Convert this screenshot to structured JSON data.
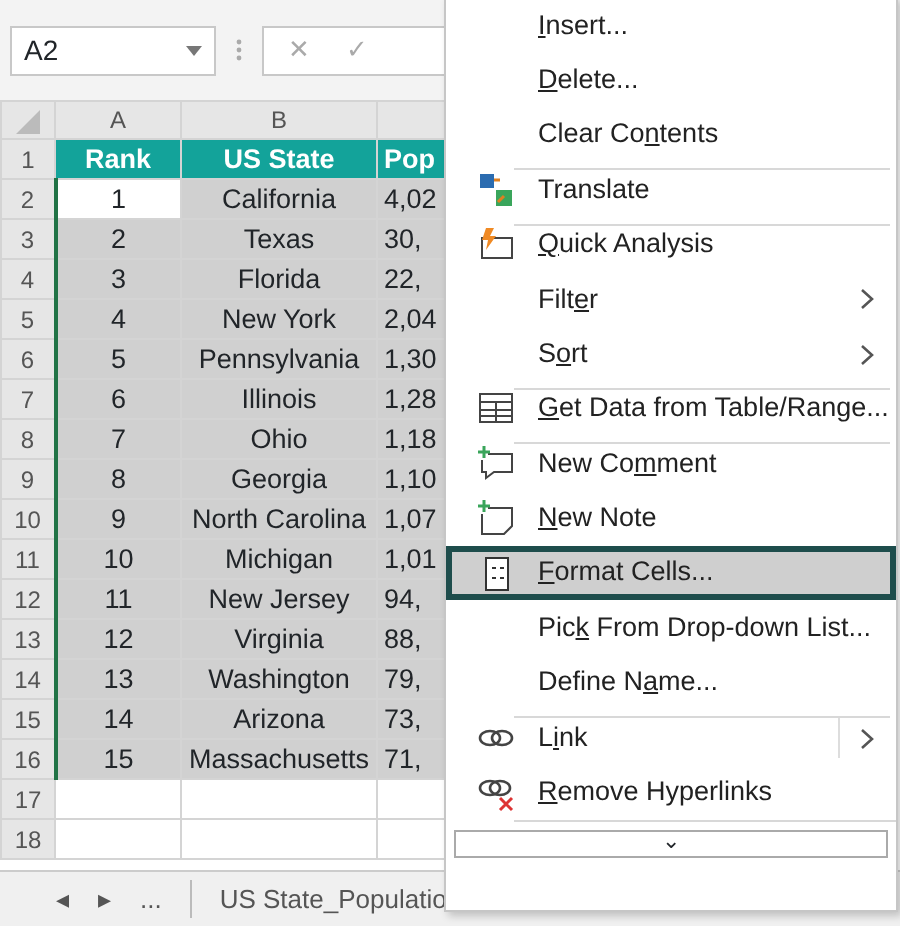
{
  "name_box": "A2",
  "formula_buttons": [
    "✕",
    "✓"
  ],
  "columns": [
    "A",
    "B"
  ],
  "rows": [
    {
      "number": "1",
      "kind": "header",
      "selected": false,
      "active_cell": false,
      "cells": [
        "Rank",
        "US State",
        "Pop"
      ]
    },
    {
      "number": "2",
      "kind": "data",
      "selected": true,
      "active_cell": true,
      "cells": [
        "1",
        "California",
        "4,02"
      ]
    },
    {
      "number": "3",
      "kind": "data",
      "selected": true,
      "active_cell": false,
      "cells": [
        "2",
        "Texas",
        "30,"
      ]
    },
    {
      "number": "4",
      "kind": "data",
      "selected": true,
      "active_cell": false,
      "cells": [
        "3",
        "Florida",
        "22,"
      ]
    },
    {
      "number": "5",
      "kind": "data",
      "selected": true,
      "active_cell": false,
      "cells": [
        "4",
        "New York",
        "2,04"
      ]
    },
    {
      "number": "6",
      "kind": "data",
      "selected": true,
      "active_cell": false,
      "cells": [
        "5",
        "Pennsylvania",
        "1,30"
      ]
    },
    {
      "number": "7",
      "kind": "data",
      "selected": true,
      "active_cell": false,
      "cells": [
        "6",
        "Illinois",
        "1,28"
      ]
    },
    {
      "number": "8",
      "kind": "data",
      "selected": true,
      "active_cell": false,
      "cells": [
        "7",
        "Ohio",
        "1,18"
      ]
    },
    {
      "number": "9",
      "kind": "data",
      "selected": true,
      "active_cell": false,
      "cells": [
        "8",
        "Georgia",
        "1,10"
      ]
    },
    {
      "number": "10",
      "kind": "data",
      "selected": true,
      "active_cell": false,
      "cells": [
        "9",
        "North Carolina",
        "1,07"
      ]
    },
    {
      "number": "11",
      "kind": "data",
      "selected": true,
      "active_cell": false,
      "cells": [
        "10",
        "Michigan",
        "1,01"
      ]
    },
    {
      "number": "12",
      "kind": "data",
      "selected": true,
      "active_cell": false,
      "cells": [
        "11",
        "New Jersey",
        "94,"
      ]
    },
    {
      "number": "13",
      "kind": "data",
      "selected": true,
      "active_cell": false,
      "cells": [
        "12",
        "Virginia",
        "88,"
      ]
    },
    {
      "number": "14",
      "kind": "data",
      "selected": true,
      "active_cell": false,
      "cells": [
        "13",
        "Washington",
        "79,"
      ]
    },
    {
      "number": "15",
      "kind": "data",
      "selected": true,
      "active_cell": false,
      "cells": [
        "14",
        "Arizona",
        "73,"
      ]
    },
    {
      "number": "16",
      "kind": "data",
      "selected": true,
      "active_cell": false,
      "cells": [
        "15",
        "Massachusetts",
        "71,"
      ]
    },
    {
      "number": "17",
      "kind": "data",
      "selected": false,
      "active_cell": false,
      "cells": [
        "",
        "",
        ""
      ]
    },
    {
      "number": "18",
      "kind": "data",
      "selected": false,
      "active_cell": false,
      "cells": [
        "",
        "",
        ""
      ]
    }
  ],
  "sheet_tabs": {
    "nav": [
      "◂",
      "▸",
      "..."
    ],
    "tab": "US State_Populatio"
  },
  "menu": [
    {
      "key": "I",
      "after": "nsert...",
      "divider_before": false,
      "submenu": false,
      "selected": false
    },
    {
      "key": "D",
      "after": "elete...",
      "divider_before": false,
      "submenu": false,
      "selected": false
    },
    {
      "before": "Clear Co",
      "key": "n",
      "after": "tents",
      "divider_before": false,
      "submenu": false,
      "selected": false
    },
    {
      "before": "Translate",
      "divider_before": true,
      "submenu": false,
      "selected": false
    },
    {
      "key": "Q",
      "after": "uick Analysis",
      "divider_before": true,
      "submenu": false,
      "selected": false
    },
    {
      "before": "Filt",
      "key": "e",
      "after": "r",
      "divider_before": false,
      "submenu": true,
      "selected": false
    },
    {
      "before": "S",
      "key": "o",
      "after": "rt",
      "divider_before": false,
      "submenu": true,
      "selected": false
    },
    {
      "key": "G",
      "after": "et Data from Table/Range...",
      "divider_before": true,
      "submenu": false,
      "selected": false
    },
    {
      "before": "New Co",
      "key": "m",
      "after": "ment",
      "divider_before": true,
      "submenu": false,
      "selected": false
    },
    {
      "key": "N",
      "after": "ew Note",
      "divider_before": false,
      "submenu": false,
      "selected": false
    },
    {
      "key": "F",
      "after": "ormat Cells...",
      "divider_before": false,
      "submenu": false,
      "selected": true
    },
    {
      "before": "Pic",
      "key": "k",
      "after": " From Drop-down List...",
      "divider_before": false,
      "submenu": false,
      "selected": false
    },
    {
      "before": "Define N",
      "key": "a",
      "after": "me...",
      "divider_before": false,
      "submenu": false,
      "selected": false
    },
    {
      "before": "L",
      "key": "i",
      "after": "nk",
      "divider_before": true,
      "submenu": true,
      "selected": false
    },
    {
      "key": "R",
      "after": "emove Hyperlinks",
      "divider_before": false,
      "submenu": false,
      "selected": false
    }
  ],
  "menu_more": "⌄"
}
